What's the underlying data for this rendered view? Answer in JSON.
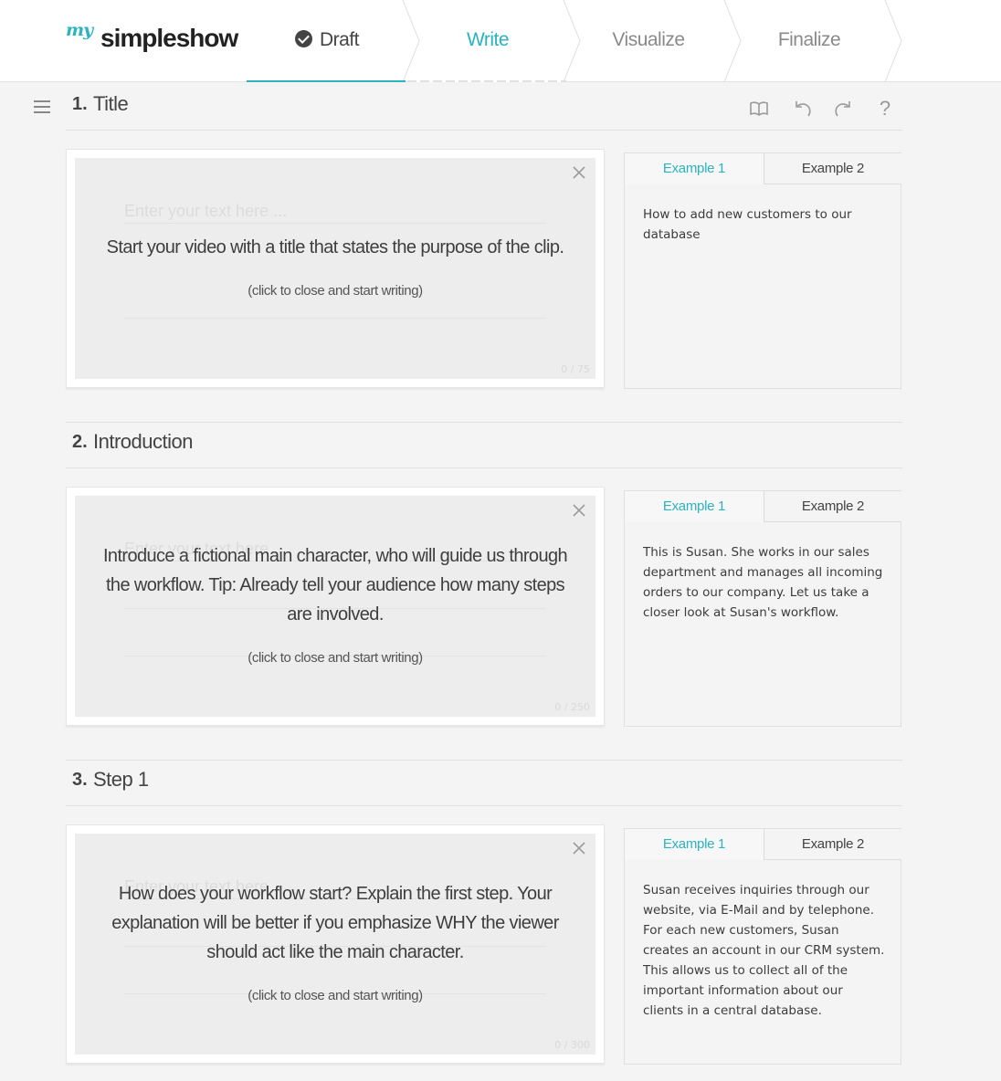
{
  "brand": {
    "prefix": "my",
    "name": "simpleshow"
  },
  "wizard_steps": [
    {
      "label": "Draft",
      "state": "done"
    },
    {
      "label": "Write",
      "state": "active"
    },
    {
      "label": "Visualize",
      "state": "pending"
    },
    {
      "label": "Finalize",
      "state": "pending"
    }
  ],
  "toolbar": {
    "icons": [
      "book-icon",
      "undo-icon",
      "redo-icon",
      "help-icon"
    ],
    "help_glyph": "?"
  },
  "colors": {
    "accent": "#2ab3c0",
    "text": "#444444",
    "background": "#f4f4f4"
  },
  "sections": [
    {
      "number": "1.",
      "title": "Title",
      "placeholder": "Enter your text here ...",
      "hint": "Start your video with a title that states the purpose of the clip.",
      "close_note": "(click to close and start writing)",
      "counter": "0 / 75",
      "example_tabs": [
        "Example 1",
        "Example 2"
      ],
      "example_text": "How to add new customers to our database"
    },
    {
      "number": "2.",
      "title": "Introduction",
      "placeholder": "Enter your text here ...",
      "hint": "Introduce a fictional main character, who will guide us through the workflow. Tip: Already tell your audience how many steps are involved.",
      "close_note": "(click to close and start writing)",
      "counter": "0 / 250",
      "example_tabs": [
        "Example 1",
        "Example 2"
      ],
      "example_text": "This is Susan. She works in our sales department and manages all incoming orders to our company. Let us take a closer look at Susan's workflow."
    },
    {
      "number": "3.",
      "title": "Step 1",
      "placeholder": "Enter your text here ...",
      "hint": "How does your workflow start? Explain the first step. Your explanation will be better if you emphasize WHY the viewer should act like the main character.",
      "close_note": "(click to close and start writing)",
      "counter": "0 / 300",
      "example_tabs": [
        "Example 1",
        "Example 2"
      ],
      "example_text": "Susan receives inquiries through our website, via E-Mail and by telephone. For each new customers, Susan creates an account in our CRM system. This allows us to collect all of the important information about our clients in a central database."
    }
  ]
}
